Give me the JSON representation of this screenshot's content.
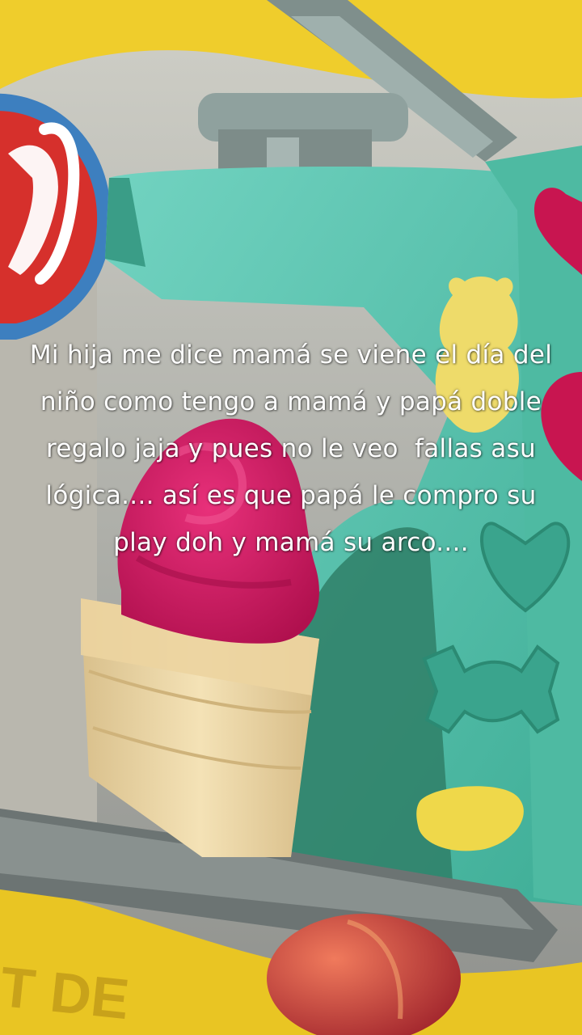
{
  "caption": {
    "text": "Mi hija me dice mamá se viene el día del niño como tengo a mamá y papá doble regalo jaja y pues no le veo  fallas asu lógica.... así es que papá le compro su play doh y mamá su arco...."
  },
  "photo": {
    "subject": "Play-Doh ice cream toy",
    "colors": {
      "toy_teal": "#5ec7b3",
      "toy_teal_dark": "#2f8f78",
      "box_yellow": "#f2cf2a",
      "ice_cream_pink": "#d0175e",
      "cone": "#efd9a8",
      "base_gray": "#7c8585",
      "logo_red": "#d42a2a"
    }
  }
}
